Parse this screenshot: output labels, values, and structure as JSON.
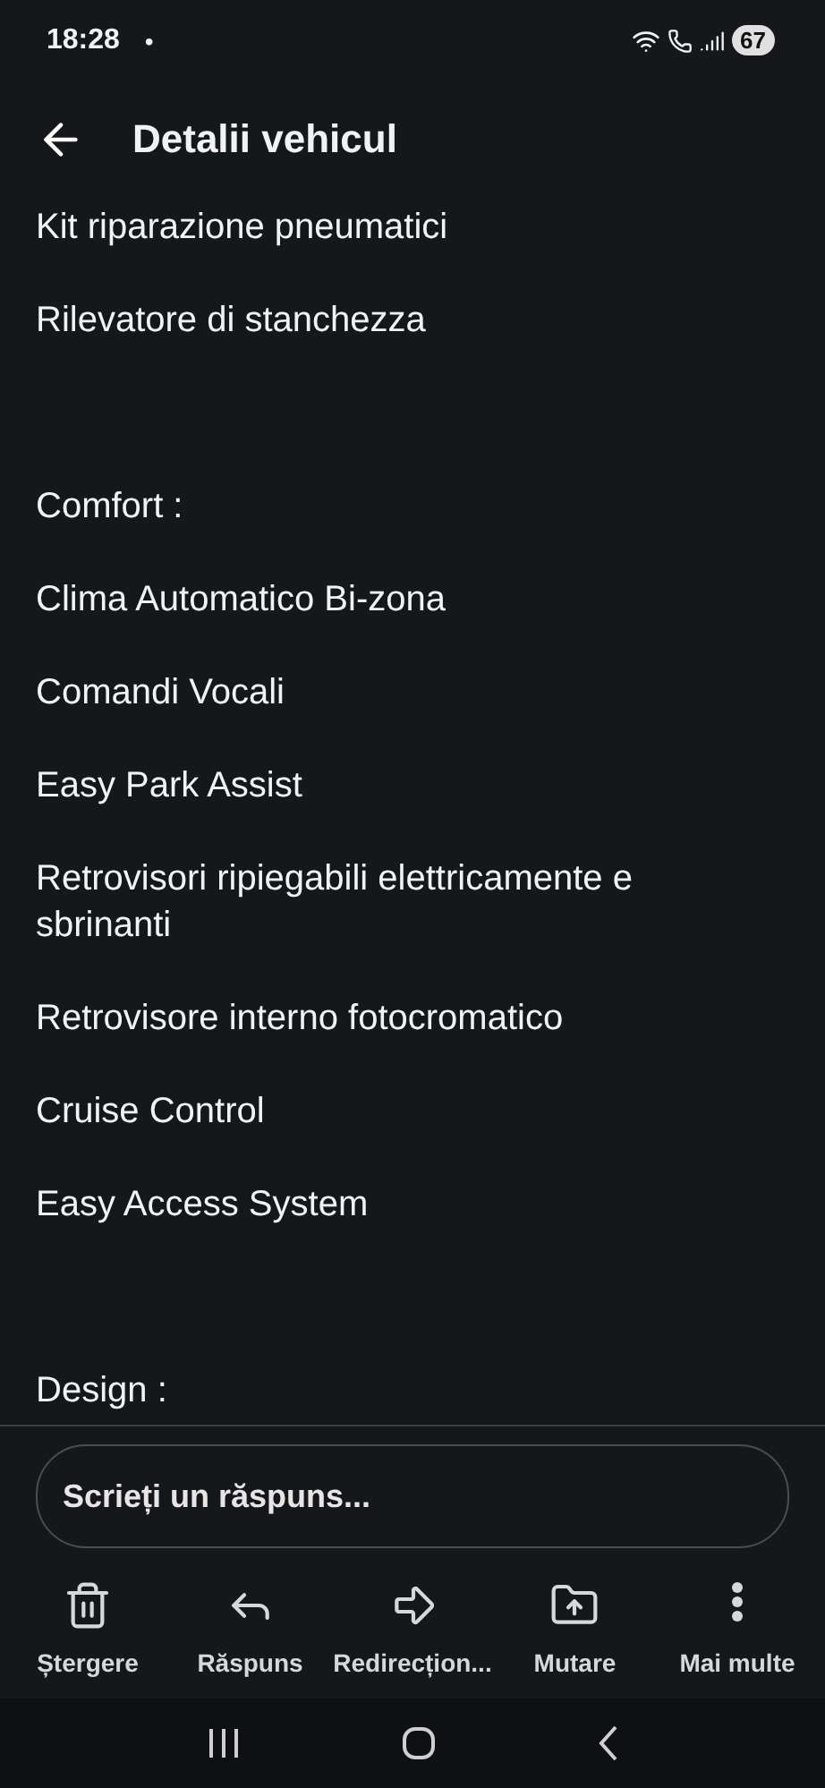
{
  "status_bar": {
    "time": "18:28",
    "dot": "•",
    "battery": "67"
  },
  "header": {
    "title": "Detalii vehicul"
  },
  "content": {
    "lines": [
      {
        "kind": "item",
        "text": "Kit riparazione pneumatici"
      },
      {
        "kind": "item",
        "text": "Rilevatore di stanchezza"
      },
      {
        "kind": "heading",
        "text": "Comfort :"
      },
      {
        "kind": "item",
        "text": "Clima Automatico Bi-zona"
      },
      {
        "kind": "item",
        "text": "Comandi Vocali"
      },
      {
        "kind": "item",
        "text": "Easy Park Assist"
      },
      {
        "kind": "item",
        "text": "Retrovisori ripiegabili elettricamente e sbrinanti"
      },
      {
        "kind": "item",
        "text": "Retrovisore interno fotocromatico"
      },
      {
        "kind": "item",
        "text": "Cruise Control"
      },
      {
        "kind": "item",
        "text": "Easy Access System"
      },
      {
        "kind": "heading",
        "text": "Design :"
      }
    ]
  },
  "reply": {
    "placeholder": "Scrieți un răspuns..."
  },
  "toolbar": [
    {
      "kind": "delete",
      "label": "Ștergere"
    },
    {
      "kind": "reply",
      "label": "Răspuns"
    },
    {
      "kind": "forward",
      "label": "Redirecțion..."
    },
    {
      "kind": "move",
      "label": "Mutare"
    },
    {
      "kind": "more",
      "label": "Mai multe"
    }
  ]
}
